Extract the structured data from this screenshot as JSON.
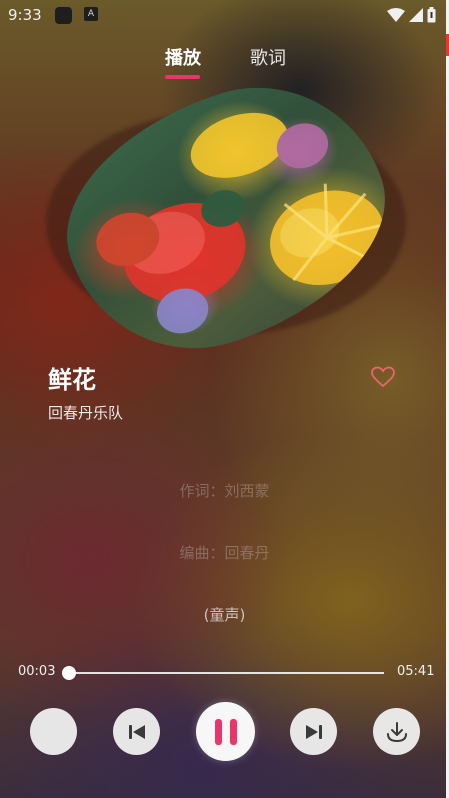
{
  "status_bar": {
    "time": "9:33",
    "app_icon_2": "A"
  },
  "tabs": [
    {
      "label": "播放"
    },
    {
      "label": "歌词"
    }
  ],
  "song": {
    "title": "鲜花",
    "artist": "回春丹乐队"
  },
  "lyrics": [
    "作词：刘西蒙",
    "编曲：回春丹",
    "(童声)"
  ],
  "progress": {
    "current": "00:03",
    "total": "05:41",
    "fraction": 0.009
  },
  "controls": {
    "mode_icon": "blank-icon",
    "prev_icon": "skip-previous-icon",
    "play_icon": "pause-icon",
    "next_icon": "skip-next-icon",
    "download_icon": "download-icon"
  },
  "colors": {
    "accent": "#e8356b",
    "heart": "#e8676b"
  }
}
